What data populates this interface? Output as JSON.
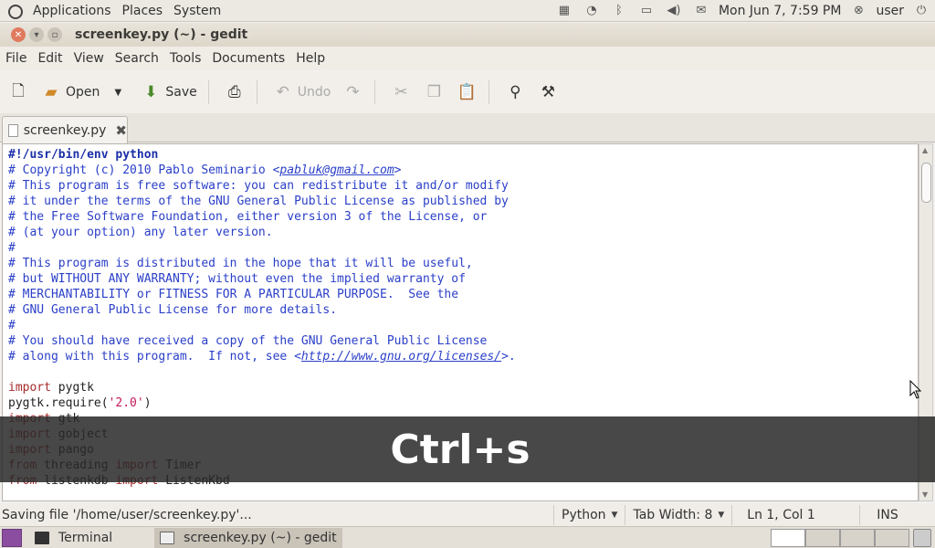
{
  "top_panel": {
    "menus": [
      "Applications",
      "Places",
      "System"
    ],
    "clock": "Mon Jun  7,  7:59 PM",
    "user": "user"
  },
  "window": {
    "title": "screenkey.py (~) - gedit"
  },
  "menubar": [
    "File",
    "Edit",
    "View",
    "Search",
    "Tools",
    "Documents",
    "Help"
  ],
  "toolbar": {
    "open_label": "Open",
    "save_label": "Save",
    "undo_label": "Undo"
  },
  "tab": {
    "label": "screenkey.py"
  },
  "code": [
    [
      {
        "t": "#!/usr/bin/env python",
        "c": "shebang"
      }
    ],
    [
      {
        "t": "# Copyright (c) 2010 Pablo Seminario <",
        "c": "cmt"
      },
      {
        "t": "pabluk@gmail.com",
        "c": "cmt url"
      },
      {
        "t": ">",
        "c": "cmt"
      }
    ],
    [
      {
        "t": "# This program is free software: you can redistribute it and/or modify",
        "c": "cmt"
      }
    ],
    [
      {
        "t": "# it under the terms of the GNU General Public License as published by",
        "c": "cmt"
      }
    ],
    [
      {
        "t": "# the Free Software Foundation, either version 3 of the License, or",
        "c": "cmt"
      }
    ],
    [
      {
        "t": "# (at your option) any later version.",
        "c": "cmt"
      }
    ],
    [
      {
        "t": "#",
        "c": "cmt"
      }
    ],
    [
      {
        "t": "# This program is distributed in the hope that it will be useful,",
        "c": "cmt"
      }
    ],
    [
      {
        "t": "# but WITHOUT ANY WARRANTY; without even the implied warranty of",
        "c": "cmt"
      }
    ],
    [
      {
        "t": "# MERCHANTABILITY or FITNESS FOR A PARTICULAR PURPOSE.  See the",
        "c": "cmt"
      }
    ],
    [
      {
        "t": "# GNU General Public License for more details.",
        "c": "cmt"
      }
    ],
    [
      {
        "t": "#",
        "c": "cmt"
      }
    ],
    [
      {
        "t": "# You should have received a copy of the GNU General Public License",
        "c": "cmt"
      }
    ],
    [
      {
        "t": "# along with this program.  If not, see <",
        "c": "cmt"
      },
      {
        "t": "http://www.gnu.org/licenses/",
        "c": "cmt url"
      },
      {
        "t": ">.",
        "c": "cmt"
      }
    ],
    [
      {
        "t": "",
        "c": "plain"
      }
    ],
    [
      {
        "t": "import",
        "c": "kw"
      },
      {
        "t": " pygtk",
        "c": "plain"
      }
    ],
    [
      {
        "t": "pygtk.require(",
        "c": "plain"
      },
      {
        "t": "'2.0'",
        "c": "str"
      },
      {
        "t": ")",
        "c": "plain"
      }
    ],
    [
      {
        "t": "import",
        "c": "kw"
      },
      {
        "t": " gtk",
        "c": "plain"
      }
    ],
    [
      {
        "t": "import",
        "c": "kw"
      },
      {
        "t": " gobject",
        "c": "plain"
      }
    ],
    [
      {
        "t": "import",
        "c": "kw"
      },
      {
        "t": " pango",
        "c": "plain"
      }
    ],
    [
      {
        "t": "from",
        "c": "kw"
      },
      {
        "t": " threading ",
        "c": "plain"
      },
      {
        "t": "import",
        "c": "kw"
      },
      {
        "t": " Timer",
        "c": "plain"
      }
    ],
    [
      {
        "t": "from",
        "c": "kw"
      },
      {
        "t": " listenkdb ",
        "c": "plain"
      },
      {
        "t": "import",
        "c": "kw"
      },
      {
        "t": " ListenKbd",
        "c": "plain"
      }
    ]
  ],
  "overlay": {
    "keys": "Ctrl+s"
  },
  "statusbar": {
    "message": "Saving file '/home/user/screenkey.py'...",
    "language": "Python",
    "tab_width": "Tab Width:  8",
    "position": "Ln 1, Col 1",
    "mode": "INS"
  },
  "taskbar": {
    "items": [
      "Terminal",
      "screenkey.py (~) - gedit"
    ]
  }
}
